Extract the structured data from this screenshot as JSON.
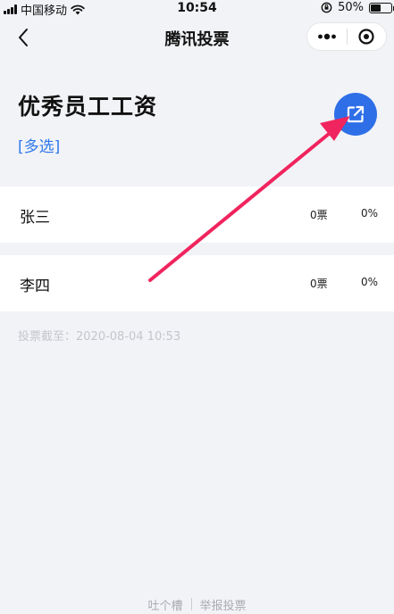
{
  "status_bar": {
    "carrier": "中国移动",
    "time": "10:54",
    "battery": "50%",
    "battery_level": 0.5
  },
  "nav": {
    "title": "腾讯投票"
  },
  "vote": {
    "title": "优秀员工工资",
    "type": "[多选]",
    "deadline": "投票截至：2020-08-04 10:53",
    "options": [
      {
        "name": "张三",
        "votes": "0票",
        "percent": "0%"
      },
      {
        "name": "李四",
        "votes": "0票",
        "percent": "0%"
      }
    ]
  },
  "footer": {
    "feedback": "吐个槽",
    "report": "举报投票"
  },
  "colors": {
    "accent": "#2e6fe8",
    "link": "#2e78ec",
    "arrow": "#f0245e",
    "background": "#f2f3f7"
  },
  "icons": {
    "back": "chevron-left-icon",
    "more": "more-dots-icon",
    "close": "target-close-icon",
    "share": "share-external-icon"
  }
}
